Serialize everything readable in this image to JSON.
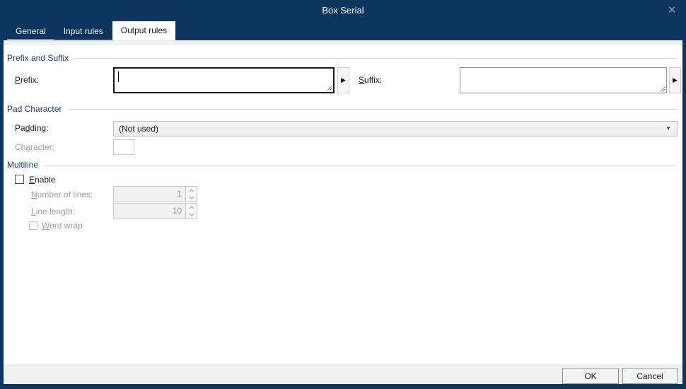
{
  "window": {
    "title": "Box Serial",
    "close_icon": "×"
  },
  "tabs": [
    {
      "label": "General",
      "active": false
    },
    {
      "label": "Input rules",
      "active": false
    },
    {
      "label": "Output rules",
      "active": true
    }
  ],
  "icons": {
    "expand_arrow": "▶",
    "dropdown_arrow": "▼"
  },
  "sections": {
    "prefix_suffix": {
      "title": "Prefix and Suffix",
      "prefix_label": "Prefix:",
      "prefix_value": "",
      "suffix_label": "Suffix:",
      "suffix_value": ""
    },
    "pad_character": {
      "title": "Pad Character",
      "padding_label": "Padding:",
      "padding_value": "(Not used)",
      "character_label": "Character:",
      "character_value": ""
    },
    "multiline": {
      "title": "Multiline",
      "enable_label": "Enable",
      "enable_checked": false,
      "lines_label": "Number of lines:",
      "lines_value": "1",
      "length_label": "Line length:",
      "length_value": "10",
      "wrap_label": "Word wrap",
      "wrap_checked": false
    }
  },
  "footer": {
    "ok_label": "OK",
    "cancel_label": "Cancel"
  },
  "colors": {
    "navy": "#0e355e",
    "section_title": "#193a68",
    "disabled_text": "#9d9d9d"
  }
}
